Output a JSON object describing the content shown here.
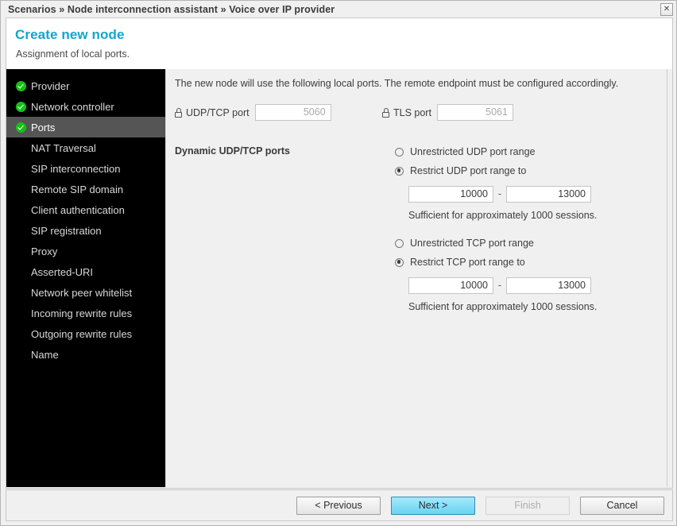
{
  "window": {
    "breadcrumb": "Scenarios » Node interconnection assistant » Voice over IP provider",
    "close_label": "✕"
  },
  "header": {
    "title": "Create new node",
    "subtitle": "Assignment of local ports.",
    "accent_color": "#13a5cb"
  },
  "sidebar": {
    "items": [
      {
        "label": "Provider",
        "done": true,
        "active": false
      },
      {
        "label": "Network controller",
        "done": true,
        "active": false
      },
      {
        "label": "Ports",
        "done": true,
        "active": true
      },
      {
        "label": "NAT Traversal",
        "done": false,
        "active": false
      },
      {
        "label": "SIP interconnection",
        "done": false,
        "active": false
      },
      {
        "label": "Remote SIP domain",
        "done": false,
        "active": false
      },
      {
        "label": "Client authentication",
        "done": false,
        "active": false
      },
      {
        "label": "SIP registration",
        "done": false,
        "active": false
      },
      {
        "label": "Proxy",
        "done": false,
        "active": false
      },
      {
        "label": "Asserted-URI",
        "done": false,
        "active": false
      },
      {
        "label": "Network peer whitelist",
        "done": false,
        "active": false
      },
      {
        "label": "Incoming rewrite rules",
        "done": false,
        "active": false
      },
      {
        "label": "Outgoing rewrite rules",
        "done": false,
        "active": false
      },
      {
        "label": "Name",
        "done": false,
        "active": false
      }
    ]
  },
  "content": {
    "intro": "The new node will use the following local ports. The remote endpoint must be configured accordingly.",
    "udp_tcp_port": {
      "label": "UDP/TCP port",
      "value": "5060",
      "icon": "lock-icon"
    },
    "tls_port": {
      "label": "TLS port",
      "value": "5061",
      "icon": "lock-icon"
    },
    "dynamic_section_label": "Dynamic UDP/TCP ports",
    "udp": {
      "unrestricted_label": "Unrestricted UDP port range",
      "unrestricted_selected": false,
      "restrict_label": "Restrict UDP port range to",
      "restrict_selected": true,
      "from": "10000",
      "dash": "-",
      "to": "13000",
      "hint": "Sufficient for approximately 1000 sessions."
    },
    "tcp": {
      "unrestricted_label": "Unrestricted TCP port range",
      "unrestricted_selected": false,
      "restrict_label": "Restrict TCP port range to",
      "restrict_selected": true,
      "from": "10000",
      "dash": "-",
      "to": "13000",
      "hint": "Sufficient for approximately 1000 sessions."
    }
  },
  "footer": {
    "previous_label": "< Previous",
    "next_label": "Next >",
    "finish_label": "Finish",
    "cancel_label": "Cancel"
  }
}
